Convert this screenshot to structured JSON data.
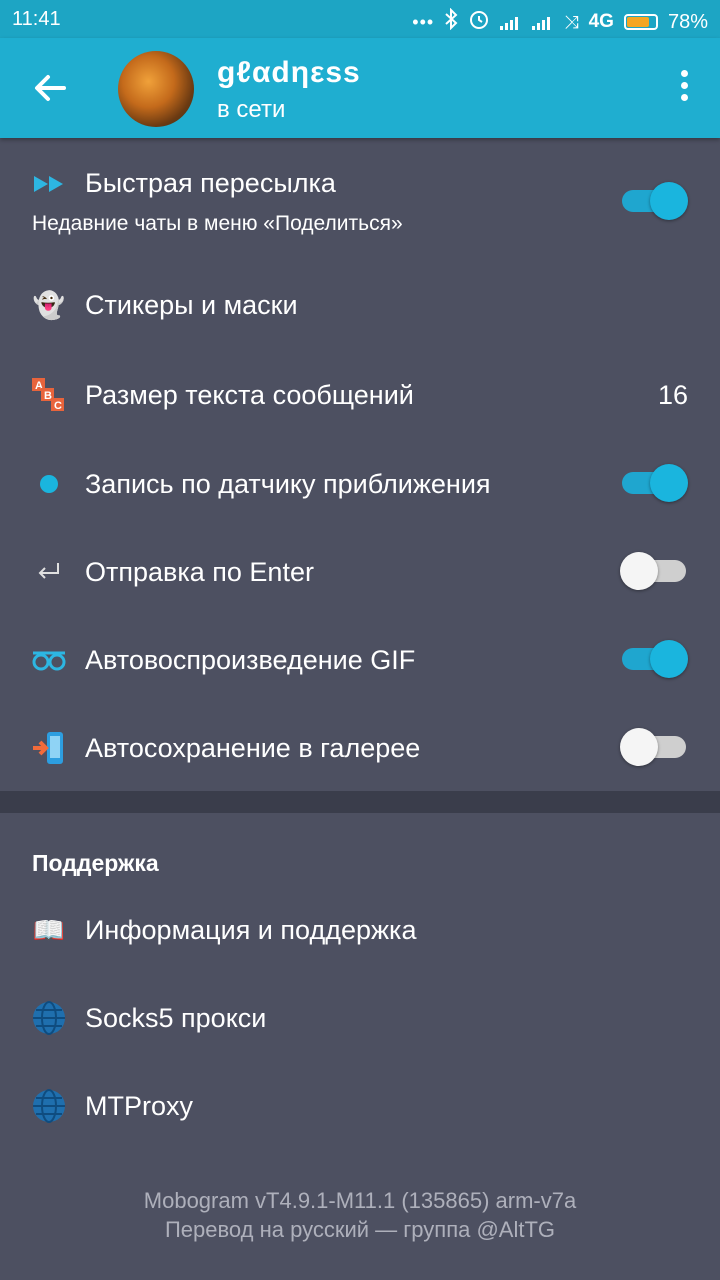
{
  "status_bar": {
    "time": "11:41",
    "network": "4G",
    "battery": "78%",
    "battery_level": 0.78
  },
  "header": {
    "title": "gℓαdηεss",
    "subtitle": "в сети"
  },
  "settings": [
    {
      "label": "Быстрая пересылка",
      "sub": "Недавние чаты в меню «Поделиться»",
      "toggle": true
    },
    {
      "label": "Стикеры и маски"
    },
    {
      "label": "Размер текста сообщений",
      "value": "16"
    },
    {
      "label": "Запись по датчику приближения",
      "toggle": true
    },
    {
      "label": "Отправка по Enter",
      "toggle": false
    },
    {
      "label": "Автовоспроизведение GIF",
      "toggle": true
    },
    {
      "label": "Автосохранение в галерее",
      "toggle": false
    }
  ],
  "support": {
    "title": "Поддержка",
    "items": [
      {
        "label": "Информация и поддержка"
      },
      {
        "label": "Socks5 прокси"
      },
      {
        "label": "MTProxy"
      }
    ]
  },
  "footer": {
    "version": "Mobogram vT4.9.1-M11.1 (135865) arm-v7a",
    "translation": "Перевод на русский — группа @AltTG"
  },
  "colors": {
    "accent": "#1faed0",
    "background": "#4d5061",
    "divider": "#3a3d4b"
  }
}
